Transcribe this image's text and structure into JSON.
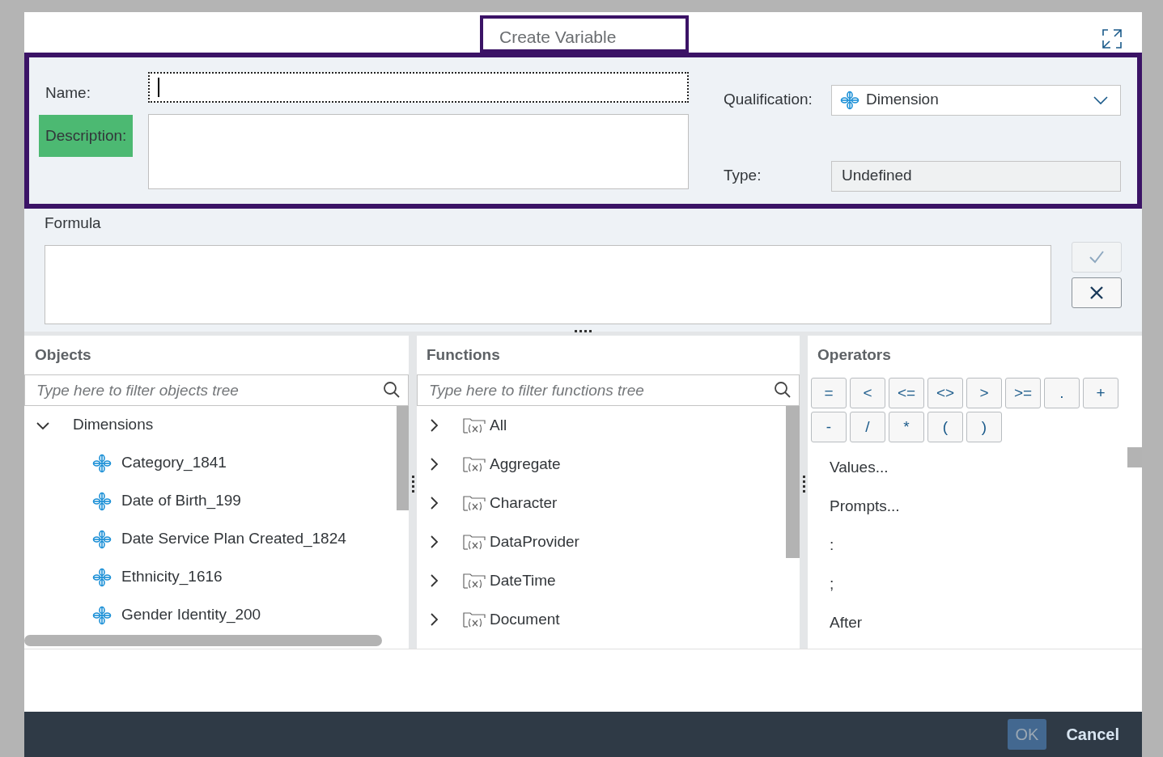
{
  "dialog": {
    "title": "Create Variable"
  },
  "definition": {
    "name": {
      "label": "Name:",
      "highlighted": false,
      "focused": true
    },
    "description": {
      "label": "Description:",
      "highlighted": true
    },
    "qualification": {
      "label": "Qualification:",
      "value": "Dimension"
    },
    "type": {
      "label": "Type:",
      "value": "Undefined",
      "disabled": true
    }
  },
  "formula": {
    "label": "Formula",
    "buttons": [
      {
        "kind": "validate",
        "disabled": true
      },
      {
        "kind": "clear",
        "disabled": false
      }
    ]
  },
  "objects": {
    "title": "Objects",
    "placeholder": "Type here to filter objects tree",
    "tree": [
      {
        "label": "Dimensions",
        "expanded": true,
        "children": [
          {
            "label": "Category_1841"
          },
          {
            "label": "Date of Birth_199"
          },
          {
            "label": "Date Service Plan Created_1824"
          },
          {
            "label": "Ethnicity_1616"
          },
          {
            "label": "Gender Identity_200"
          }
        ]
      }
    ]
  },
  "functions": {
    "title": "Functions",
    "placeholder": "Type here to filter functions tree",
    "items": [
      {
        "label": "All",
        "expanded": false
      },
      {
        "label": "Aggregate",
        "expanded": false
      },
      {
        "label": "Character",
        "expanded": false
      },
      {
        "label": "DataProvider",
        "expanded": false
      },
      {
        "label": "DateTime",
        "expanded": false
      },
      {
        "label": "Document",
        "expanded": false
      }
    ]
  },
  "operators": {
    "title": "Operators",
    "buttons": [
      "=",
      "<",
      "<=",
      "<>",
      ">",
      ">=",
      ".",
      "+",
      "-",
      "/",
      "*",
      "(",
      ")"
    ],
    "items": [
      "Values...",
      "Prompts...",
      ":",
      ";",
      "After"
    ]
  },
  "footer": {
    "buttons": [
      {
        "label": "OK",
        "disabled": true
      },
      {
        "label": "Cancel",
        "disabled": false
      }
    ]
  }
}
